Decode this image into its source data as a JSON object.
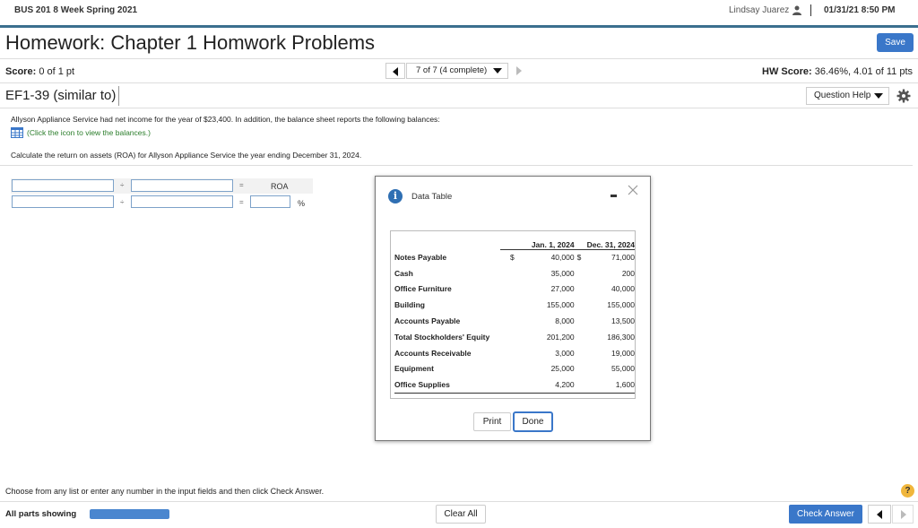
{
  "header": {
    "course": "BUS 201 8 Week Spring 2021",
    "user": "Lindsay Juarez",
    "datetime": "01/31/21 8:50 PM"
  },
  "homework": {
    "title": "Homework: Chapter 1 Homwork Problems",
    "save_label": "Save",
    "score_label": "Score:",
    "score_value": "0 of 1 pt",
    "question_select": "7 of 7 (4 complete)",
    "hw_score_label": "HW Score:",
    "hw_score_value": "36.46%, 4.01 of 11 pts"
  },
  "question": {
    "id": "EF1-39 (similar to)",
    "help_label": "Question Help",
    "text": "Allyson Appliance Service had net income for the year of $23,400. In addition, the balance sheet reports the following balances:",
    "link_text": "(Click the icon to view the balances.)",
    "instruction": "Calculate the return on assets (ROA) for Allyson Appliance Service the year ending December 31, 2024."
  },
  "calculator": {
    "row1_op1": "÷",
    "row1_op2": "=",
    "row1_result_label": "ROA",
    "row2_op1": "÷",
    "row2_op2": "=",
    "row2_unit": "%"
  },
  "modal": {
    "title": "Data Table",
    "col1_header": "Jan. 1, 2024",
    "col2_header": "Dec. 31, 2024",
    "rows": [
      {
        "label": "Notes Payable",
        "cur1": "$",
        "v1": "40,000",
        "cur2": "$",
        "v2": "71,000"
      },
      {
        "label": "Cash",
        "cur1": "",
        "v1": "35,000",
        "cur2": "",
        "v2": "200"
      },
      {
        "label": "Office Furniture",
        "cur1": "",
        "v1": "27,000",
        "cur2": "",
        "v2": "40,000"
      },
      {
        "label": "Building",
        "cur1": "",
        "v1": "155,000",
        "cur2": "",
        "v2": "155,000"
      },
      {
        "label": "Accounts Payable",
        "cur1": "",
        "v1": "8,000",
        "cur2": "",
        "v2": "13,500"
      },
      {
        "label": "Total Stockholders' Equity",
        "cur1": "",
        "v1": "201,200",
        "cur2": "",
        "v2": "186,300"
      },
      {
        "label": "Accounts Receivable",
        "cur1": "",
        "v1": "3,000",
        "cur2": "",
        "v2": "19,000"
      },
      {
        "label": "Equipment",
        "cur1": "",
        "v1": "25,000",
        "cur2": "",
        "v2": "55,000"
      },
      {
        "label": "Office Supplies",
        "cur1": "",
        "v1": "4,200",
        "cur2": "",
        "v2": "1,600"
      }
    ],
    "print_label": "Print",
    "done_label": "Done"
  },
  "footer": {
    "message": "Choose from any list or enter any number in the input fields and then click Check Answer.",
    "parts_label": "All parts showing",
    "progress_fraction": 1.0,
    "clear_label": "Clear All",
    "check_label": "Check Answer",
    "help_glyph": "?"
  },
  "colors": {
    "accent": "#3a77c9",
    "header_rule": "#3b6f8f",
    "link": "#2a7d2a",
    "help_badge": "#f0b63c"
  }
}
